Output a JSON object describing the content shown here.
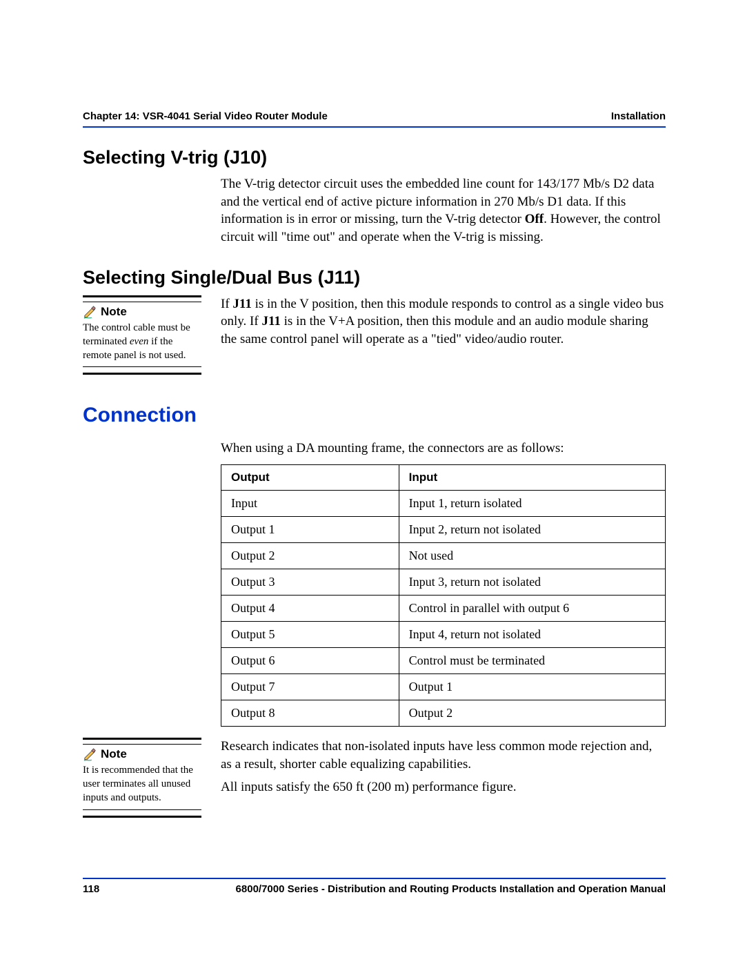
{
  "header": {
    "left": "Chapter 14: VSR-4041 Serial Video Router Module",
    "right": "Installation"
  },
  "section1": {
    "title": "Selecting V-trig (J10)",
    "para_pre": "The V-trig detector circuit uses the embedded line count for 143/177 Mb/s D2 data and the vertical end of active picture information in 270 Mb/s D1 data. If this information is in error or missing, turn the V-trig detector ",
    "para_bold": "Off",
    "para_post": ". However, the control circuit will \"time out\" and operate when the V-trig is missing."
  },
  "section2": {
    "title": "Selecting Single/Dual Bus (J11)",
    "note_label": "Note",
    "note_text_pre": "The control cable must be terminated ",
    "note_text_em": "even",
    "note_text_post": " if the remote panel is not used.",
    "para_s1_pre": "If ",
    "para_s1_b": "J11",
    "para_s1_post": " is in the V position, then this module responds to control as a single video bus only. If ",
    "para_s2_b": "J11",
    "para_s2_post": " is in the V+A position, then this module and an audio module sharing the same control panel will operate as a \"tied\" video/audio router."
  },
  "section3": {
    "title": "Connection",
    "lead": "When using a DA mounting frame, the connectors are as follows:",
    "table": {
      "headers": [
        "Output",
        "Input"
      ],
      "rows": [
        [
          "Input",
          "Input 1, return isolated"
        ],
        [
          "Output 1",
          "Input 2, return not isolated"
        ],
        [
          "Output 2",
          "Not used"
        ],
        [
          "Output 3",
          "Input 3, return not isolated"
        ],
        [
          "Output 4",
          "Control in parallel with output 6"
        ],
        [
          "Output 5",
          "Input 4, return not isolated"
        ],
        [
          "Output 6",
          "Control must be terminated"
        ],
        [
          "Output 7",
          "Output 1"
        ],
        [
          "Output 8",
          "Output 2"
        ]
      ]
    },
    "note_label": "Note",
    "note_text": "It is recommended that the user terminates all unused inputs and outputs.",
    "para_after1": "Research indicates that non-isolated inputs have less common mode rejection and, as a result, shorter cable equalizing capabilities.",
    "para_after2": "All inputs satisfy the 650 ft (200 m) performance figure."
  },
  "footer": {
    "page": "118",
    "manual": "6800/7000 Series - Distribution and Routing Products Installation and Operation Manual"
  },
  "icons": {
    "pencil": "pencil-icon"
  }
}
